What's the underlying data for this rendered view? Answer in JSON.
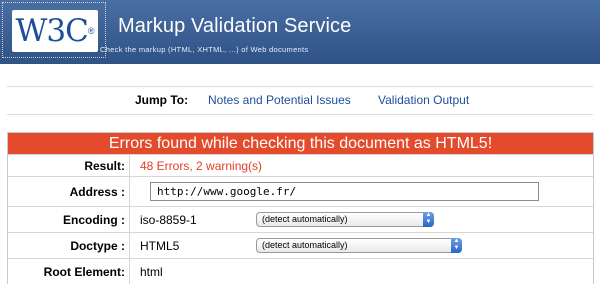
{
  "banner": {
    "logo_text": "W3C",
    "logo_reg": "®",
    "title": "Markup Validation Service",
    "tagline": "Check the markup (HTML, XHTML, ...) of Web documents",
    "colors": {
      "banner_bg": "#36598c",
      "logo_text": "#1c4f99"
    }
  },
  "jumpbar": {
    "label": "Jump To:",
    "links": [
      "Notes and Potential Issues",
      "Validation Output"
    ],
    "colors": {
      "link": "#1d4e9a"
    }
  },
  "results": {
    "header": "Errors found while checking this document as HTML5!",
    "colors": {
      "header_bg": "#e44a2c",
      "error_text": "#e23e22"
    },
    "rows": {
      "result": {
        "label": "Result:",
        "value": "48 Errors, 2 warning(s)"
      },
      "address": {
        "label": "Address :",
        "value": "http://www.google.fr/"
      },
      "encoding": {
        "label": "Encoding :",
        "value": "iso-8859-1",
        "select": "(detect automatically)"
      },
      "doctype": {
        "label": "Doctype :",
        "value": "HTML5",
        "select": "(detect automatically)"
      },
      "root": {
        "label": "Root Element:",
        "value": "html"
      }
    }
  }
}
